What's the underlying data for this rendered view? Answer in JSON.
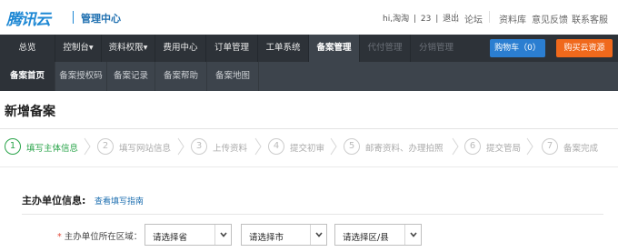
{
  "header": {
    "logo_text": "腾讯云",
    "console_title": "管理中心",
    "user_greeting": "hi,淘淘",
    "user_id": "23",
    "logout": "退出",
    "links": [
      "论坛",
      "资料库",
      "意见反馈",
      "联系客服"
    ]
  },
  "nav": {
    "items": [
      {
        "label": "总览"
      },
      {
        "label": "控制台▾"
      },
      {
        "label": "资料权限▾"
      },
      {
        "label": "费用中心"
      },
      {
        "label": "订单管理"
      },
      {
        "label": "工单系统"
      },
      {
        "label": "备案管理"
      },
      {
        "label": "代付管理"
      },
      {
        "label": "分销管理"
      }
    ],
    "cart_label": "购物车（0）",
    "buy_label": "购买云资源"
  },
  "subnav": {
    "items": [
      {
        "label": "备案首页"
      },
      {
        "label": "备案授权码"
      },
      {
        "label": "备案记录"
      },
      {
        "label": "备案帮助"
      },
      {
        "label": "备案地图"
      }
    ]
  },
  "page": {
    "title": "新增备案"
  },
  "steps": [
    {
      "num": "1",
      "label": "填写主体信息"
    },
    {
      "num": "2",
      "label": "填写网站信息"
    },
    {
      "num": "3",
      "label": "上传资料"
    },
    {
      "num": "4",
      "label": "提交初审"
    },
    {
      "num": "5",
      "label": "邮寄资料、办理拍照"
    },
    {
      "num": "6",
      "label": "提交管局"
    },
    {
      "num": "7",
      "label": "备案完成"
    }
  ],
  "form": {
    "section_title": "主办单位信息:",
    "guide_link": "查看填写指南",
    "region_label": "主办单位所在区域：",
    "required_mark": "*",
    "province": "请选择省",
    "city": "请选择市",
    "county": "请选择区/县"
  },
  "colors": {
    "nav_bg": "#2d3238",
    "subnav_bg": "#3d444c",
    "active_step": "#2aa44a",
    "cart_button": "#2b7ed1",
    "buy_button": "#f0691c",
    "link": "#1e6fb0"
  }
}
